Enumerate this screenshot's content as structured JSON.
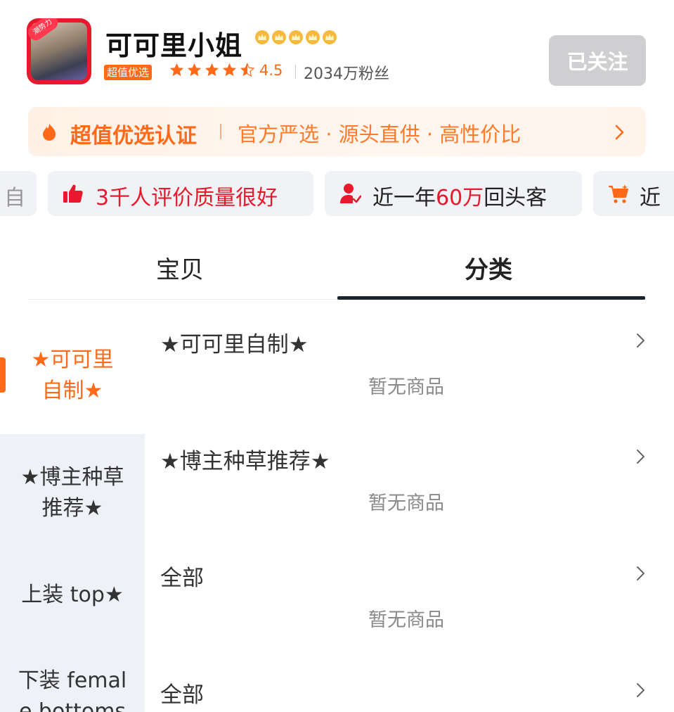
{
  "store": {
    "name": "可可里小姐",
    "avatar_badge": "潮势力",
    "tag": "超值优选",
    "rating": "4.5",
    "fans": "2034万粉丝",
    "follow_label": "已关注",
    "accent_color": "#ff6a1a"
  },
  "certification": {
    "title": "超值优选认证",
    "description": "官方严选 · 源头直供 · 高性价比"
  },
  "highlights": {
    "chip0_partial": "自",
    "chip1": {
      "prefix": "3千人评价",
      "emphasis": "质量很好"
    },
    "chip2": {
      "prefix": "近一年",
      "emphasis": "60万",
      "suffix": "回头客"
    },
    "chip3_partial": "近"
  },
  "tabs": {
    "items": [
      "宝贝",
      "分类"
    ],
    "active": "分类"
  },
  "sidebar": {
    "items": [
      {
        "line1": "★可可里",
        "line2": "自制★"
      },
      {
        "line1": "★博主种草",
        "line2": "推荐★"
      },
      {
        "line1": "上装 top★",
        "line2": ""
      },
      {
        "line1": "下装 femal",
        "line2": "e bottoms"
      }
    ]
  },
  "categories": [
    {
      "title": "★可可里自制★",
      "empty": "暂无商品"
    },
    {
      "title": "★博主种草推荐★",
      "empty": "暂无商品"
    },
    {
      "title": "全部",
      "empty": "暂无商品"
    },
    {
      "title": "全部",
      "empty": ""
    }
  ]
}
